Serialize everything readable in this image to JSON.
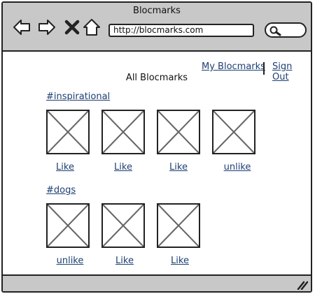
{
  "window": {
    "title": "Blocmarks"
  },
  "toolbar": {
    "back_icon": "arrow-left-icon",
    "forward_icon": "arrow-right-icon",
    "close_icon": "x-icon",
    "home_icon": "home-icon",
    "url": "http://blocmarks.com",
    "search_icon": "search-icon"
  },
  "header": {
    "my_blocmarks": "My Blocmarks",
    "sign_out": "Sign Out",
    "page_title": "All Blocmarks"
  },
  "groups": [
    {
      "tag": "#inspirational",
      "items": [
        {
          "action": "Like"
        },
        {
          "action": "Like"
        },
        {
          "action": "Like"
        },
        {
          "action": "unlike"
        }
      ]
    },
    {
      "tag": "#dogs",
      "items": [
        {
          "action": "unlike"
        },
        {
          "action": "Like"
        },
        {
          "action": "Like"
        }
      ]
    }
  ],
  "colors": {
    "chrome": "#c8c8c8",
    "link": "#1c3f73",
    "border": "#222222"
  }
}
